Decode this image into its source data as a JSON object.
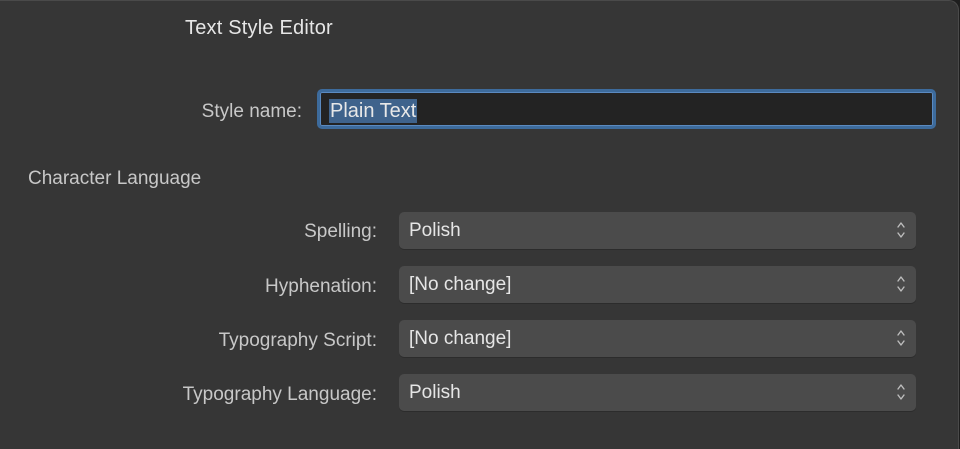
{
  "window": {
    "title": "Text Style Editor"
  },
  "style_name": {
    "label": "Style name:",
    "value": "Plain Text"
  },
  "character_language": {
    "section_title": "Character Language",
    "fields": [
      {
        "label": "Spelling:",
        "value": "Polish"
      },
      {
        "label": "Hyphenation:",
        "value": "[No change]"
      },
      {
        "label": "Typography Script:",
        "value": "[No change]"
      },
      {
        "label": "Typography Language:",
        "value": "Polish"
      }
    ]
  },
  "colors": {
    "background": "#363636",
    "focus_ring": "#3d6b9c",
    "selection": "#3f638c",
    "popup": "#4b4b4b"
  },
  "icons": {
    "popup_indicator": "chevron-up-down-icon"
  }
}
